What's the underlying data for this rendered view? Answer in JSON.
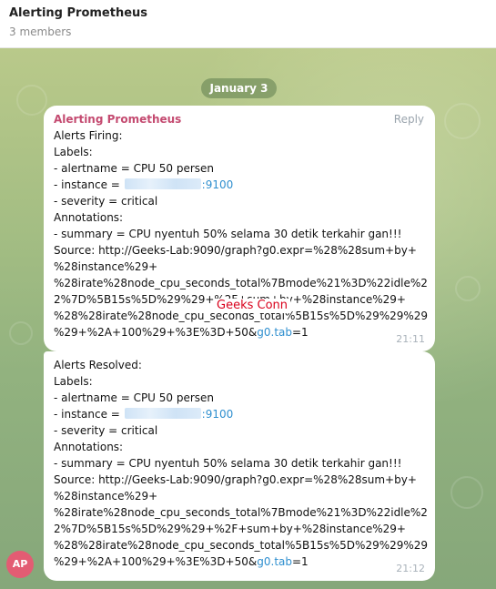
{
  "header": {
    "title": "Alerting Prometheus",
    "subtitle": "3 members"
  },
  "date_separator": "January 3",
  "overlay": {
    "text": "Geeks Conn",
    "color": "#d9001b"
  },
  "colors": {
    "sender": "#c44a70",
    "link": "#2f8fcf",
    "avatar": "#e35c73"
  },
  "messages": [
    {
      "sender": "Alerting Prometheus",
      "reply_label": "Reply",
      "title": "Alerts Firing:",
      "labels_heading": "Labels:",
      "alertname": " - alertname = CPU 50 persen",
      "instance_prefix": " - instance = ",
      "instance_port": ":9100",
      "severity": " - severity = critical",
      "annotations_heading": "Annotations:",
      "summary": " - summary = CPU nyentuh 50% selama 30 detik terkahir gan!!!",
      "source_line1": "Source: http://Geeks-Lab:9090/graph?g0.expr=%28%28sum+by+",
      "source_line2": "%28instance%29+",
      "source_line3": "%28irate%28node_cpu_seconds_total%7Bmode%21%3D%22idle%2",
      "source_line4": "2%7D%5B15s%5D%29%29+%2F+sum+by+%28instance%29+",
      "source_line5": "%28%28irate%28node_cpu_seconds_total%5B15s%5D%29%29%29",
      "source_line6_prefix": "%29+%2A+100%29+%3E%3D+50&",
      "source_line6_link": "g0.tab",
      "source_line6_suffix": "=1",
      "time": "21:11"
    },
    {
      "title": "Alerts Resolved:",
      "labels_heading": "Labels:",
      "alertname": " - alertname = CPU 50 persen",
      "instance_prefix": " - instance = ",
      "instance_port": ":9100",
      "severity": " - severity = critical",
      "annotations_heading": "Annotations:",
      "summary": " - summary = CPU nyentuh 50% selama 30 detik terkahir gan!!!",
      "source_line1": "Source: http://Geeks-Lab:9090/graph?g0.expr=%28%28sum+by+",
      "source_line2": "%28instance%29+",
      "source_line3": "%28irate%28node_cpu_seconds_total%7Bmode%21%3D%22idle%2",
      "source_line4": "2%7D%5B15s%5D%29%29+%2F+sum+by+%28instance%29+",
      "source_line5": "%28%28irate%28node_cpu_seconds_total%5B15s%5D%29%29%29",
      "source_line6_prefix": "%29+%2A+100%29+%3E%3D+50&",
      "source_line6_link": "g0.tab",
      "source_line6_suffix": "=1",
      "time": "21:12"
    }
  ],
  "avatar": {
    "initials": "AP"
  }
}
